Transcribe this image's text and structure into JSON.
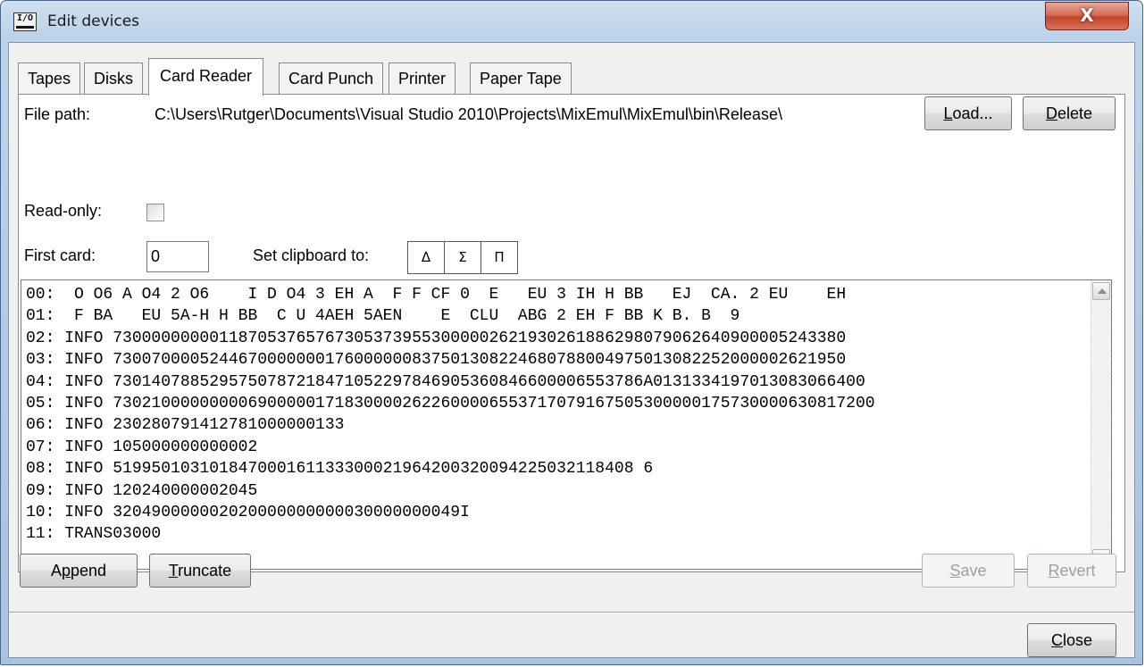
{
  "window": {
    "title": "Edit devices",
    "icon_text": "I/O",
    "close_glyph": "X"
  },
  "tabs": [
    {
      "label": "Tapes",
      "active": false
    },
    {
      "label": "Disks",
      "active": false
    },
    {
      "label": "Card Reader",
      "active": true
    },
    {
      "label": "Card Punch",
      "active": false
    },
    {
      "label": "Printer",
      "active": false
    },
    {
      "label": "Paper Tape",
      "active": false
    }
  ],
  "form": {
    "file_path_label": "File path:",
    "file_path_value": "C:\\Users\\Rutger\\Documents\\Visual Studio 2010\\Projects\\MixEmul\\MixEmul\\bin\\Release\\",
    "load_prefix": "",
    "load_accel": "L",
    "load_rest": "oad...",
    "delete_accel": "D",
    "delete_rest": "elete",
    "readonly_label": "Read-only:",
    "readonly_checked": false,
    "first_card_label": "First card:",
    "first_card_value": "0",
    "clipboard_label": "Set clipboard to:",
    "clipboard_symbols": [
      "Δ",
      "Σ",
      "Π"
    ]
  },
  "cards": [
    "00:  O O6 A O4 2 O6    I D O4 3 EH A  F F CF 0  E   EU 3 IH H BB   EJ  CA. 2 EU    EH",
    "01:  F BA   EU 5A-H H BB  C U 4AEH 5AEN    E  CLU  ABG 2 EH F BB K B. B  9",
    "02: INFO 7300000000011870537657673053739553000002621930261886298079062640900005243380",
    "03: INFO 7300700005244670000000176000000837501308224680788004975013082252000002621950",
    "04: INFO 7301407885295750787218471052297846905360846600006553786A0131334197013083066400",
    "05: INFO 7302100000000069000001718300002622600006553717079167505300000175730000630817200",
    "06: INFO 230280791412781000000133",
    "07: INFO 105000000000002",
    "08: INFO 519950103101847000161133300021964200320094225032118408 6",
    "09: INFO 120240000002045",
    "10: INFO 320490000002020000000000030000000049I",
    "11: TRANS03000"
  ],
  "bottom": {
    "append_pre": "A",
    "append_accel": "p",
    "append_rest": "pend",
    "truncate_accel": "T",
    "truncate_rest": "runcate",
    "save_accel": "S",
    "save_rest": "ave",
    "revert_accel": "R",
    "revert_rest": "evert",
    "close_accel": "C",
    "close_rest": "lose"
  }
}
